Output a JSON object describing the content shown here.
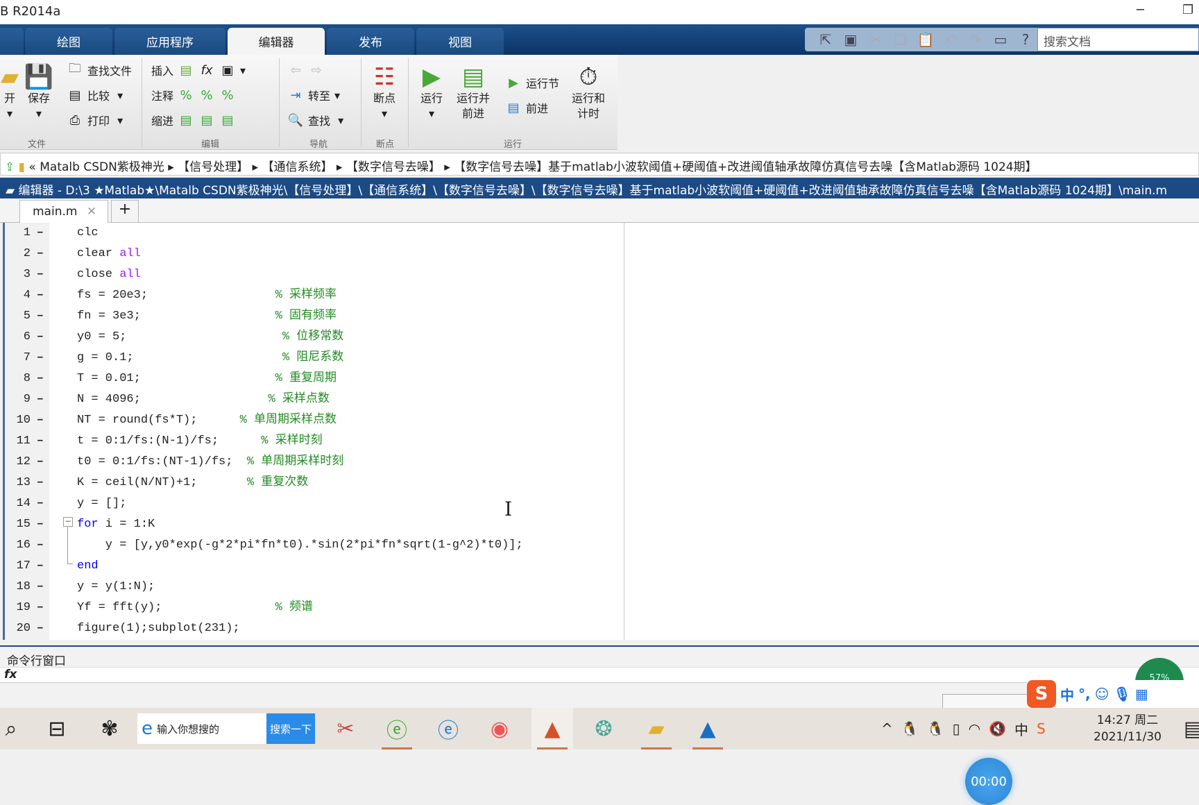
{
  "window": {
    "title": "B R2014a",
    "minimize": "─",
    "restore": "❐"
  },
  "tabs": [
    {
      "label": "绘图"
    },
    {
      "label": "应用程序"
    },
    {
      "label": "编辑器",
      "active": true
    },
    {
      "label": "发布"
    },
    {
      "label": "视图"
    }
  ],
  "quick_access": {
    "search_placeholder": "搜索文档"
  },
  "ribbon": {
    "file": {
      "open": "开",
      "save": "保存",
      "find_files": "查找文件",
      "compare": "比较",
      "print": "打印",
      "group": "文件"
    },
    "edit": {
      "insert": "插入",
      "comment": "注释",
      "indent": "缩进",
      "fx": "fx",
      "group": "编辑"
    },
    "navigate": {
      "goto": "转至",
      "find": "查找",
      "group": "导航"
    },
    "breakpoints": {
      "label": "断点",
      "group": "断点"
    },
    "run": {
      "run": "运行",
      "run_advance_1": "运行并",
      "run_advance_2": "前进",
      "run_section": "运行节",
      "advance": "前进",
      "run_time_1": "运行和",
      "run_time_2": "计时",
      "group": "运行"
    }
  },
  "address": {
    "prefix": "«",
    "parts": [
      "Matalb CSDN紫极神光",
      "【信号处理】",
      "【通信系统】",
      "【数字信号去噪】",
      "【数字信号去噪】基于matlab小波软阈值+硬阈值+改进阈值轴承故障仿真信号去噪【含Matlab源码 1024期】"
    ]
  },
  "editor": {
    "title": "编辑器 - D:\\3 ★Matlab★\\Matalb CSDN紫极神光\\【信号处理】\\【通信系统】\\【数字信号去噪】\\【数字信号去噪】基于matlab小波软阈值+硬阈值+改进阈值轴承故障仿真信号去噪【含Matlab源码 1024期】\\main.m",
    "file_tab": "main.m",
    "add_tab": "+"
  },
  "code": [
    [
      {
        "t": "clc",
        "c": ""
      }
    ],
    [
      {
        "t": "clear ",
        "c": ""
      },
      {
        "t": "all",
        "c": "str"
      }
    ],
    [
      {
        "t": "close ",
        "c": ""
      },
      {
        "t": "all",
        "c": "str"
      }
    ],
    [
      {
        "t": "fs = 20e3;                  ",
        "c": ""
      },
      {
        "t": "% 采样频率",
        "c": "cm"
      }
    ],
    [
      {
        "t": "fn = 3e3;                   ",
        "c": ""
      },
      {
        "t": "% 固有频率",
        "c": "cm"
      }
    ],
    [
      {
        "t": "y0 = 5;                      ",
        "c": ""
      },
      {
        "t": "% 位移常数",
        "c": "cm"
      }
    ],
    [
      {
        "t": "g = 0.1;                     ",
        "c": ""
      },
      {
        "t": "% 阻尼系数",
        "c": "cm"
      }
    ],
    [
      {
        "t": "T = 0.01;                   ",
        "c": ""
      },
      {
        "t": "% 重复周期",
        "c": "cm"
      }
    ],
    [
      {
        "t": "N = 4096;                  ",
        "c": ""
      },
      {
        "t": "% 采样点数",
        "c": "cm"
      }
    ],
    [
      {
        "t": "NT = round(fs*T);      ",
        "c": ""
      },
      {
        "t": "% 单周期采样点数",
        "c": "cm"
      }
    ],
    [
      {
        "t": "t = 0:1/fs:(N-1)/fs;      ",
        "c": ""
      },
      {
        "t": "% 采样时刻",
        "c": "cm"
      }
    ],
    [
      {
        "t": "t0 = 0:1/fs:(NT-1)/fs;  ",
        "c": ""
      },
      {
        "t": "% 单周期采样时刻",
        "c": "cm"
      }
    ],
    [
      {
        "t": "K = ceil(N/NT)+1;       ",
        "c": ""
      },
      {
        "t": "% 重复次数",
        "c": "cm"
      }
    ],
    [
      {
        "t": "y = [];",
        "c": ""
      }
    ],
    [
      {
        "t": "for",
        "c": "kw"
      },
      {
        "t": " i = 1:K",
        "c": ""
      }
    ],
    [
      {
        "t": "    y = [y,y0*exp(-g*2*pi*fn*t0).*sin(2*pi*fn*sqrt(1-g^2)*t0)];",
        "c": ""
      }
    ],
    [
      {
        "t": "end",
        "c": "kw"
      }
    ],
    [
      {
        "t": "y = y(1:N);",
        "c": ""
      }
    ],
    [
      {
        "t": "Yf = fft(y);                ",
        "c": ""
      },
      {
        "t": "% 频谱",
        "c": "cm"
      }
    ],
    [
      {
        "t": "figure(1);subplot(231);",
        "c": ""
      }
    ]
  ],
  "line_marker": "–",
  "timer": "00:00",
  "command_window": {
    "label": "命令行窗口",
    "prompt": "fx"
  },
  "status": {
    "gauge": "57%"
  },
  "ime": {
    "logo": "S",
    "mode": "中",
    "punct": "°,"
  },
  "taskbar": {
    "search_placeholder": "输入你想搜的",
    "search_button": "搜索一下",
    "tray_lang": "中",
    "time": "14:27 周二",
    "date": "2021/11/30"
  }
}
